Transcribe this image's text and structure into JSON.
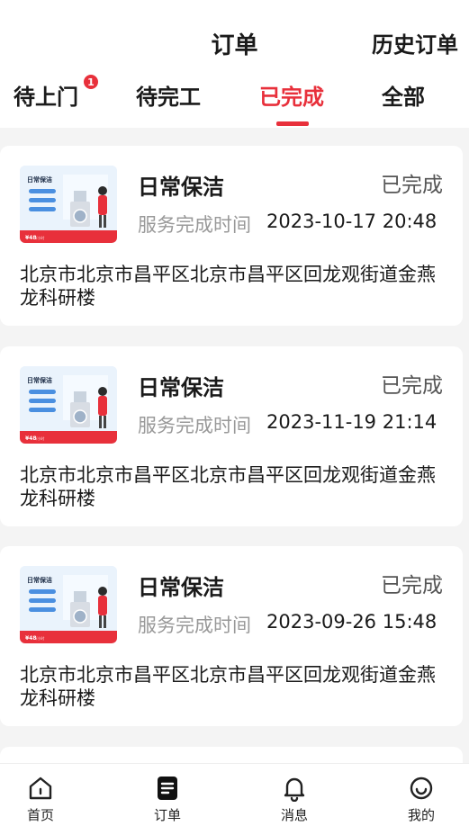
{
  "header": {
    "title": "订单",
    "history_label": "历史订单"
  },
  "tabs": [
    {
      "label": "待上门",
      "badge": "1"
    },
    {
      "label": "待完工"
    },
    {
      "label": "已完成",
      "active": true
    },
    {
      "label": "全部"
    }
  ],
  "orders": [
    {
      "service": "日常保洁",
      "status": "已完成",
      "time_label": "服务完成时间",
      "time_value": "2023-10-17 20:48",
      "address": "北京市北京市昌平区北京市昌平区回龙观街道金燕龙科研楼"
    },
    {
      "service": "日常保洁",
      "status": "已完成",
      "time_label": "服务完成时间",
      "time_value": "2023-11-19 21:14",
      "address": "北京市北京市昌平区北京市昌平区回龙观街道金燕龙科研楼"
    },
    {
      "service": "日常保洁",
      "status": "已完成",
      "time_label": "服务完成时间",
      "time_value": "2023-09-26 15:48",
      "address": "北京市北京市昌平区北京市昌平区回龙观街道金燕龙科研楼"
    }
  ],
  "thumbnail": {
    "title": "日常保洁",
    "price": "¥48",
    "price_unit": "/小时"
  },
  "nav": [
    {
      "label": "首页",
      "icon": "home-icon"
    },
    {
      "label": "订单",
      "icon": "orders-icon",
      "active": true
    },
    {
      "label": "消息",
      "icon": "bell-icon"
    },
    {
      "label": "我的",
      "icon": "smiley-icon"
    }
  ],
  "colors": {
    "accent": "#e8303b",
    "background": "#f4f4f4"
  }
}
